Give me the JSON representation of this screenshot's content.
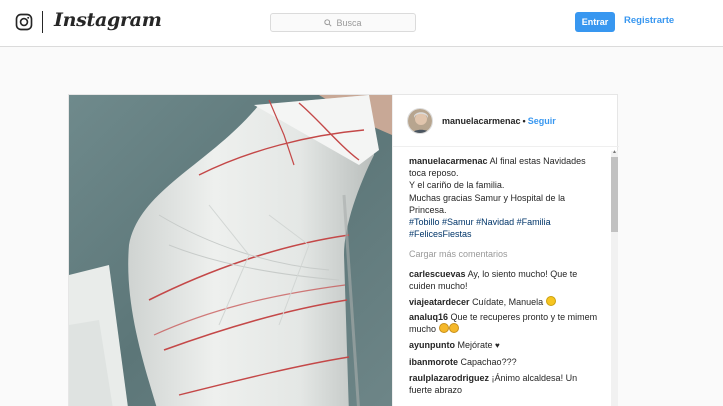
{
  "header": {
    "brand": "Instagram",
    "search_placeholder": "Busca",
    "login_label": "Entrar",
    "signup_label": "Registrarte"
  },
  "post": {
    "owner": "manuelacarmenac",
    "separator": "•",
    "follow_label": "Seguir",
    "caption": {
      "user": "manuelacarmenac",
      "text_lines": [
        "Al final estas Navidades",
        "toca reposo.",
        "Y el cariño de la familia.",
        "Muchas gracias Samur y Hospital de la",
        "Princesa."
      ],
      "hashtags": [
        "#Tobillo",
        "#Samur",
        "#Navidad",
        "#Familia",
        "#FelicesFiestas"
      ]
    },
    "load_more": "Cargar más comentarios",
    "comments": [
      {
        "user": "carlescuevas",
        "text": "Ay, lo siento mucho! Que te cuiden mucho!"
      },
      {
        "user": "viajeatardecer",
        "text": "Cuídate, Manuela",
        "emoji": "smile"
      },
      {
        "user": "analuq16",
        "text": "Que te recuperes pronto y te mimem mucho",
        "emoji": "tongue-pair"
      },
      {
        "user": "ayunpunto",
        "text": "Mejórate",
        "emoji": "heart"
      },
      {
        "user": "ibanmorote",
        "text": "Capachao???"
      },
      {
        "user": "raulplazarodriguez",
        "text": "¡Ánimo alcaldesa! Un fuerte abrazo"
      }
    ]
  },
  "icons": {
    "logo": "instagram-camera-icon",
    "search": "search-icon",
    "avatar": "user-avatar"
  },
  "colors": {
    "accent": "#3897f0",
    "hashtag": "#003569",
    "muted": "#999999"
  }
}
